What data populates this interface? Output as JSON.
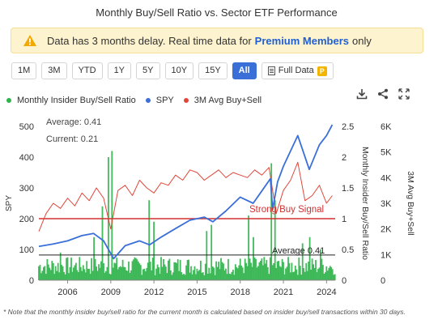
{
  "title": "Monthly Buy/Sell Ratio vs. Sector ETF Performance",
  "banner": {
    "text_before": "Data has 3 months delay. Real time data for",
    "link": "Premium Members",
    "text_after": "only"
  },
  "range_buttons": [
    "1M",
    "3M",
    "YTD",
    "1Y",
    "5Y",
    "10Y",
    "15Y",
    "All"
  ],
  "active_range": "All",
  "full_data": {
    "label": "Full Data",
    "badge": "P"
  },
  "legend": [
    {
      "label": "Monthly Insider Buy/Sell Ratio",
      "color": "#2fb34a"
    },
    {
      "label": "SPY",
      "color": "#3a6fd8"
    },
    {
      "label": "3M Avg Buy+Sell",
      "color": "#e0473a"
    }
  ],
  "toolbar_icons": [
    "download-icon",
    "share-icon",
    "fullscreen-icon"
  ],
  "chart_data": {
    "type": "line",
    "x_ticks": [
      "2006",
      "2009",
      "2012",
      "2015",
      "2018",
      "2021",
      "2024"
    ],
    "x_range": [
      2004.0,
      2024.6
    ],
    "axes": {
      "spy": {
        "label": "SPY",
        "ticks": [
          "0",
          "100",
          "200",
          "300",
          "400",
          "500"
        ],
        "range": [
          0,
          500
        ]
      },
      "ratio": {
        "label": "Monthly Insider Buy/Sell Ratio",
        "ticks": [
          "0",
          "0.5",
          "1",
          "1.5",
          "2",
          "2.5"
        ],
        "range": [
          0,
          2.5
        ]
      },
      "avg": {
        "label": "3M Avg Buy+Sell",
        "ticks": [
          "0",
          "1K",
          "2K",
          "3K",
          "4K",
          "5K",
          "6K"
        ],
        "range": [
          0,
          6000
        ]
      }
    },
    "annotations": {
      "average": "Average: 0.41",
      "current": "Current: 0.21",
      "strong_buy": "Strong Buy Signal",
      "average_line": "Average 0.41"
    },
    "reference_lines": {
      "strong_buy_ratio": 1.0,
      "average_ratio": 0.41
    },
    "spy_series": {
      "name": "SPY",
      "x": [
        2004.0,
        2005.0,
        2006.0,
        2007.0,
        2007.8,
        2008.5,
        2009.2,
        2010.0,
        2011.0,
        2011.7,
        2012.5,
        2013.5,
        2014.5,
        2015.5,
        2016.1,
        2017.0,
        2018.0,
        2018.9,
        2019.5,
        2020.1,
        2020.25,
        2020.6,
        2021.0,
        2022.0,
        2022.8,
        2023.5,
        2024.0,
        2024.4
      ],
      "y": [
        110,
        118,
        128,
        145,
        152,
        128,
        70,
        112,
        128,
        115,
        140,
        168,
        195,
        205,
        190,
        225,
        270,
        250,
        290,
        330,
        230,
        320,
        370,
        470,
        360,
        440,
        470,
        505
      ]
    },
    "avg_series": {
      "name": "3M Avg Buy+Sell",
      "x": [
        2004.0,
        2004.5,
        2005.0,
        2005.5,
        2006.0,
        2006.5,
        2007.0,
        2007.5,
        2008.0,
        2008.5,
        2009.0,
        2009.5,
        2010.0,
        2010.5,
        2011.0,
        2011.5,
        2012.0,
        2012.5,
        2013.0,
        2013.5,
        2014.0,
        2014.5,
        2015.0,
        2015.5,
        2016.0,
        2016.5,
        2017.0,
        2017.5,
        2018.0,
        2018.5,
        2019.0,
        2019.5,
        2020.0,
        2020.5,
        2021.0,
        2021.5,
        2022.0,
        2022.5,
        2023.0,
        2023.5,
        2024.0,
        2024.4
      ],
      "y": [
        1900,
        2600,
        3000,
        2800,
        3200,
        2900,
        3400,
        3100,
        3600,
        3200,
        2000,
        3500,
        3700,
        3300,
        3900,
        3600,
        3400,
        3800,
        3700,
        4100,
        3900,
        4300,
        4200,
        3900,
        4100,
        4300,
        4000,
        4200,
        4100,
        4000,
        4300,
        4100,
        4400,
        2600,
        3500,
        3900,
        4600,
        3100,
        3300,
        3700,
        3000,
        3300
      ]
    },
    "ratio_spikes": {
      "x": [
        2005.5,
        2007.8,
        2008.4,
        2008.8,
        2009.1,
        2011.7,
        2012.0,
        2015.7,
        2016.0,
        2018.6,
        2018.9,
        2020.2,
        2020.4,
        2022.3,
        2022.8,
        2023.6,
        2024.3
      ],
      "y": [
        0.45,
        0.7,
        1.2,
        2.0,
        2.1,
        1.3,
        0.95,
        0.8,
        0.9,
        1.05,
        0.7,
        1.9,
        1.3,
        0.6,
        0.7,
        0.5,
        0.21
      ]
    }
  },
  "footnote": "* Note that the monthly insider buy/sell ratio for the current month is calculated based on insider buy/sell transactions within 30 days."
}
